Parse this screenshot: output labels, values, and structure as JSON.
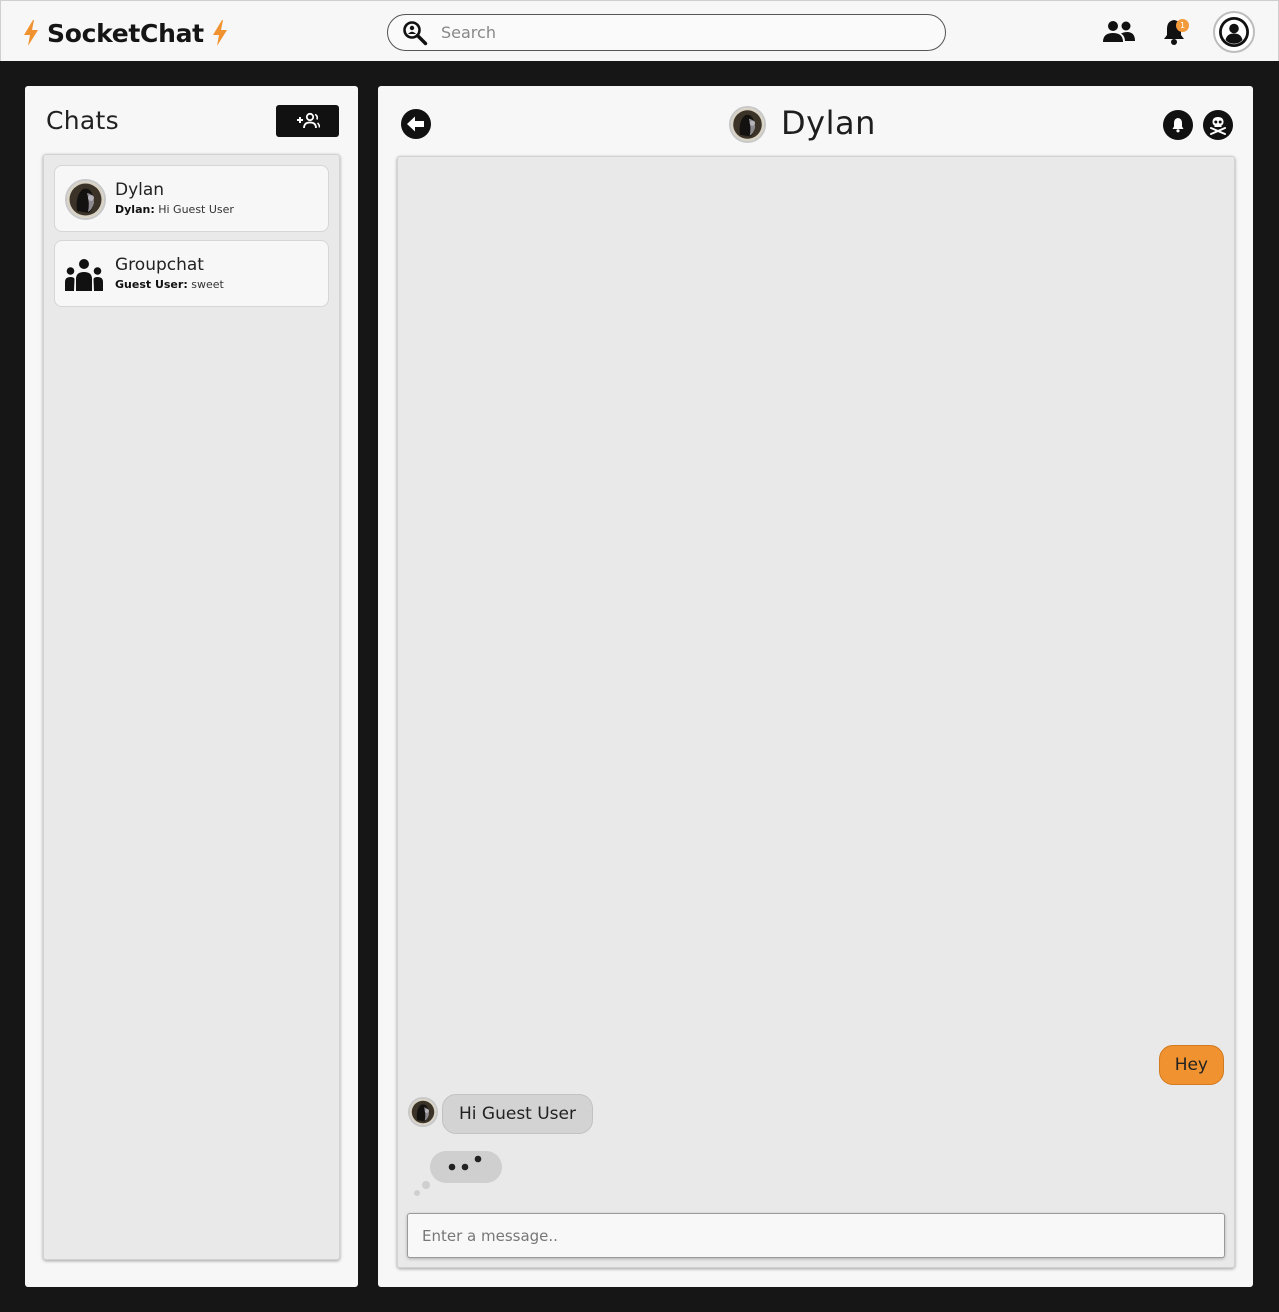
{
  "header": {
    "brand": "SocketChat",
    "search_placeholder": "Search",
    "notifications_count": "1"
  },
  "sidebar": {
    "title": "Chats",
    "chats": [
      {
        "name": "Dylan",
        "preview_sender": "Dylan:",
        "preview_text": " Hi Guest User"
      },
      {
        "name": "Groupchat",
        "preview_sender": "Guest User:",
        "preview_text": " sweet"
      }
    ]
  },
  "conversation": {
    "contact_name": "Dylan",
    "messages": [
      {
        "direction": "sent",
        "text": "Hey"
      },
      {
        "direction": "received",
        "text": "Hi Guest User"
      }
    ],
    "composer_placeholder": "Enter a message.."
  },
  "colors": {
    "accent": "#f0922f",
    "page_background": "#161616",
    "panel": "#f7f7f7",
    "pane": "#e9e9e9"
  }
}
